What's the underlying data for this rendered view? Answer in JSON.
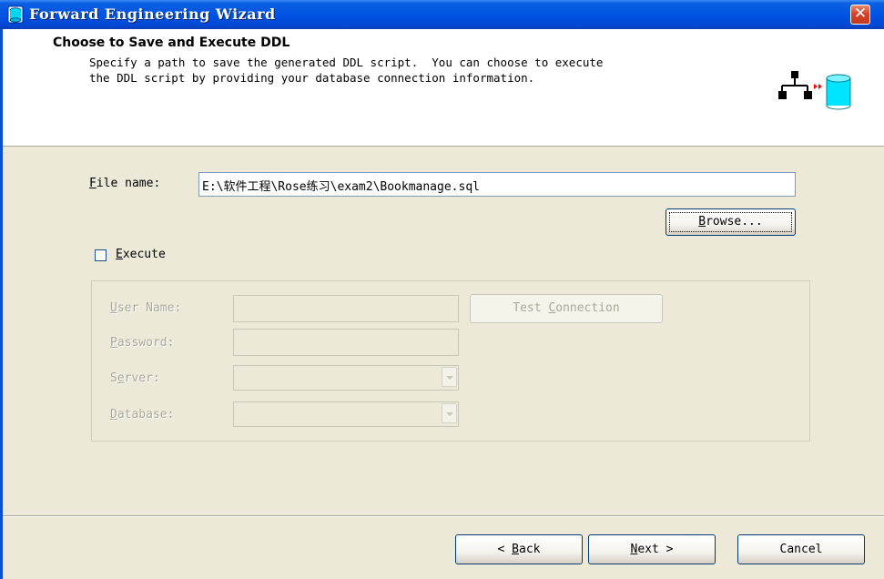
{
  "window": {
    "title": "Forward Engineering Wizard",
    "close_symbol": "✕",
    "icons": {
      "app": "database-icon",
      "close": "close-icon",
      "header": "schema-to-database-icon"
    }
  },
  "header": {
    "title": "Choose to Save and Execute DDL",
    "description_line1": "Specify a path to save the generated DDL script.  You can choose to execute",
    "description_line2": "the DDL script by providing your database connection information."
  },
  "file": {
    "label_hotkey": "F",
    "label_rest": "ile name:",
    "value": "E:\\软件工程\\Rose练习\\exam2\\Bookmanage.sql"
  },
  "browse_button": {
    "hotkey": "B",
    "rest": "rowse..."
  },
  "execute": {
    "hotkey": "E",
    "rest": "xecute",
    "checked": false
  },
  "connection": {
    "user_name": {
      "hotkey": "U",
      "rest": "ser Name:",
      "value": ""
    },
    "password": {
      "hotkey": "P",
      "rest": "assword:",
      "value": ""
    },
    "server": {
      "prefix": "S",
      "hotkey": "e",
      "rest": "rver:",
      "value": ""
    },
    "database": {
      "hotkey": "D",
      "rest": "atabase:",
      "value": ""
    },
    "test_connection": {
      "prefix": "Test ",
      "hotkey": "C",
      "rest": "onnection"
    }
  },
  "footer": {
    "back": {
      "prefix": "< ",
      "hotkey": "B",
      "rest": "ack"
    },
    "next": {
      "hotkey": "N",
      "rest": "ext >"
    },
    "cancel": "Cancel"
  },
  "colors": {
    "titlebar": "#0054e3",
    "dialog_bg": "#ece9d8",
    "disabled_text": "#aca899",
    "db_cyan": "#00e5ff",
    "arrow_red": "#ff0000"
  }
}
